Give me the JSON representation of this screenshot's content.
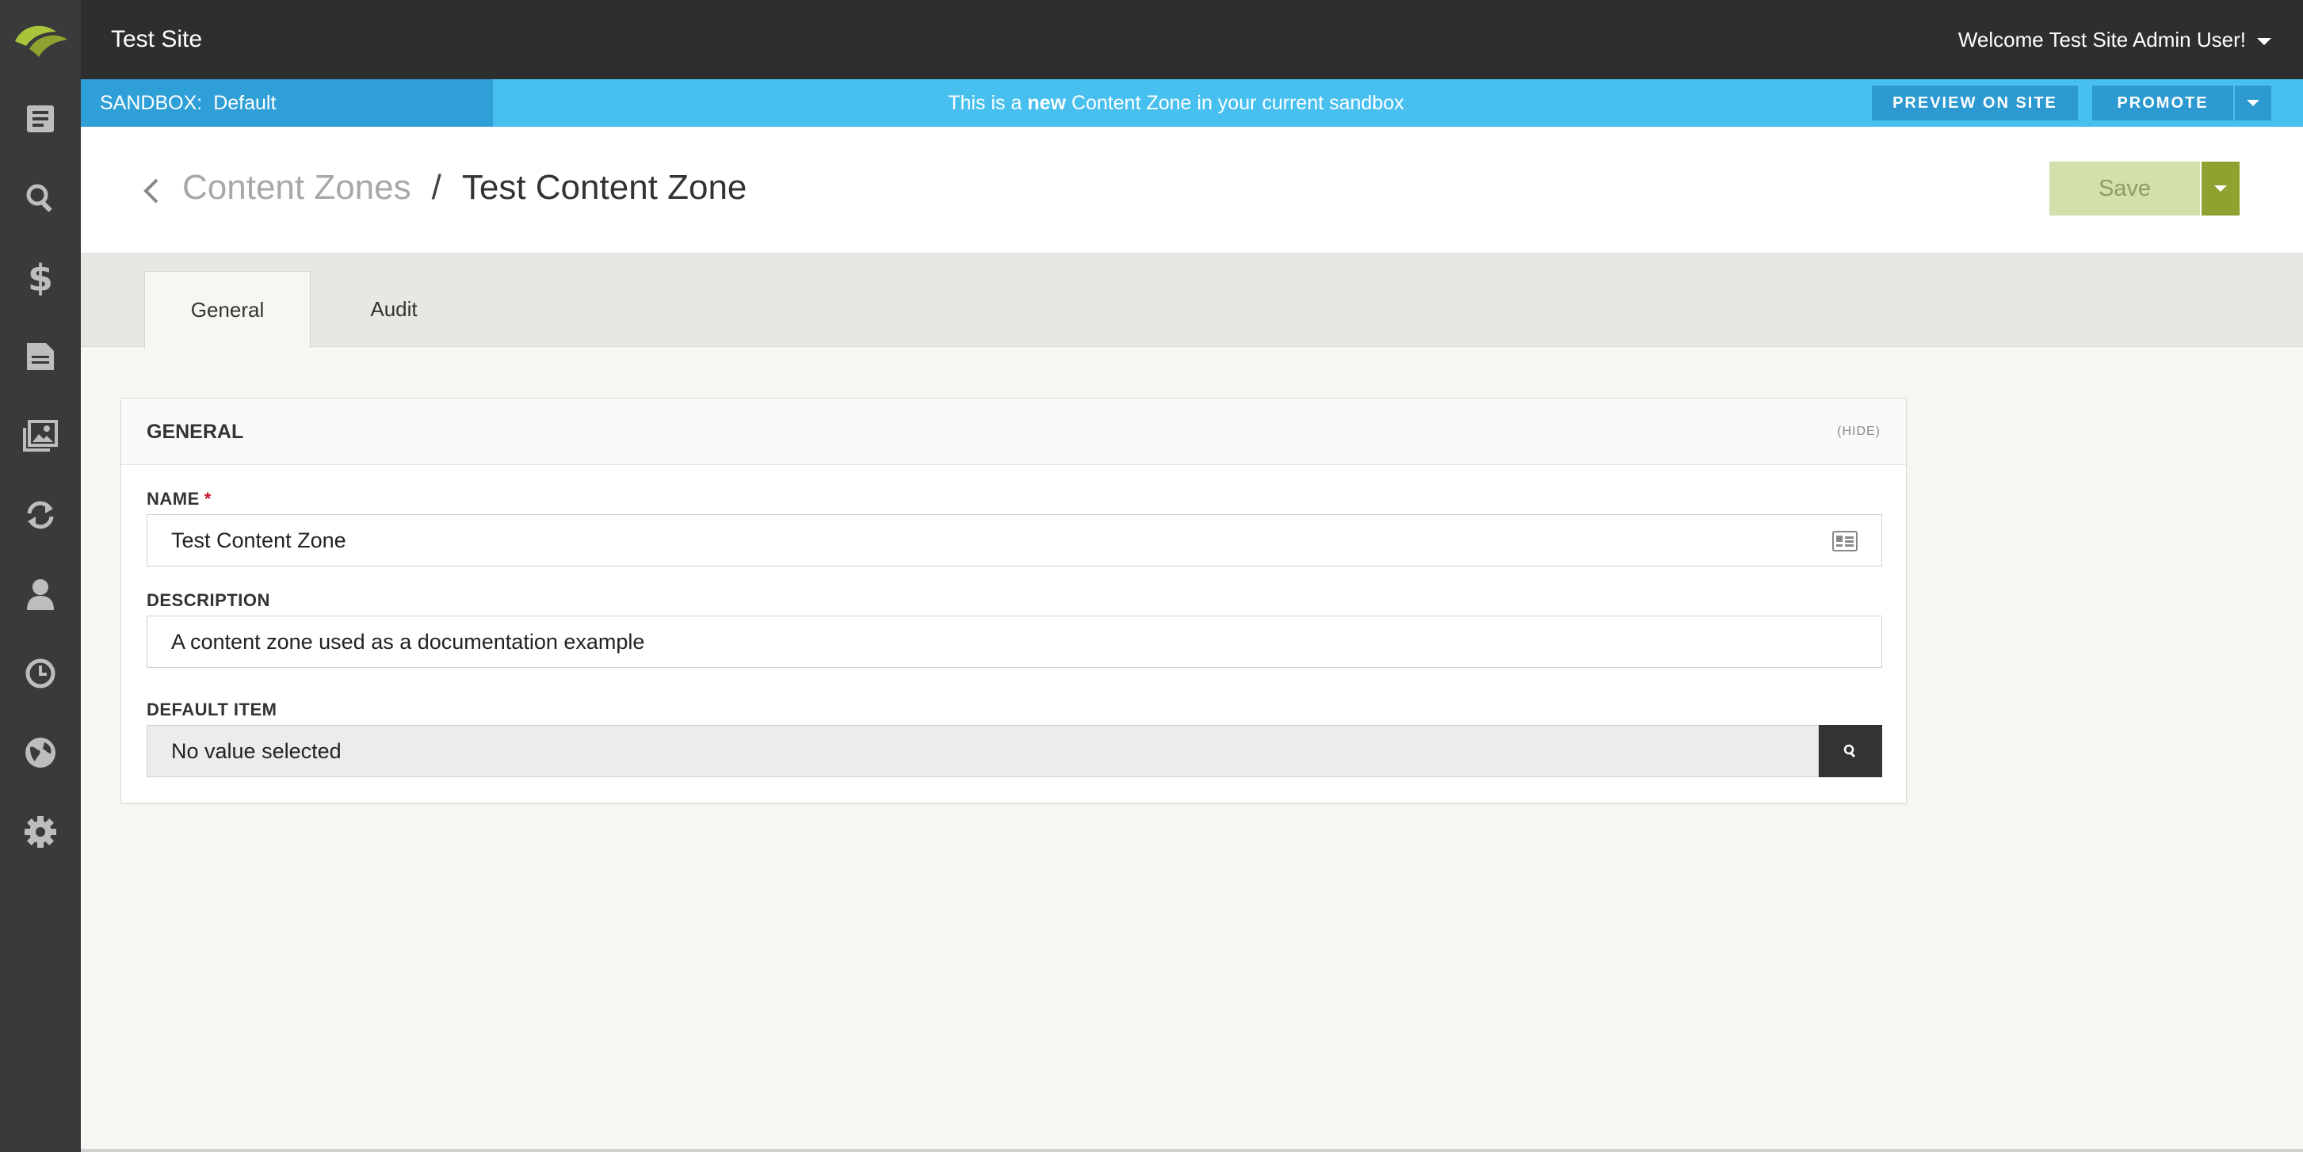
{
  "topbar": {
    "site_title": "Test Site",
    "welcome": "Welcome Test Site Admin User!"
  },
  "nav": {
    "items": [
      "content-icon",
      "search-icon",
      "pricing-icon",
      "catalog-icon",
      "assets-icon",
      "sync-icon",
      "customers-icon",
      "history-icon",
      "sites-icon",
      "settings-icon"
    ]
  },
  "sandbox": {
    "label": "SANDBOX:",
    "value": "Default",
    "message_prefix": "This is a",
    "message_bold": "new",
    "message_suffix": "Content Zone in your current sandbox",
    "preview_label": "PREVIEW ON SITE",
    "promote_label": "PROMOTE"
  },
  "header": {
    "breadcrumb_parent": "Content Zones",
    "separator": "/",
    "breadcrumb_current": "Test Content Zone",
    "save_label": "Save"
  },
  "tabs": [
    {
      "label": "General",
      "active": true
    },
    {
      "label": "Audit",
      "active": false
    }
  ],
  "panel": {
    "title": "GENERAL",
    "hide_label": "(HIDE)",
    "fields": {
      "name": {
        "label": "NAME",
        "required_mark": "*",
        "value": "Test Content Zone"
      },
      "description": {
        "label": "DESCRIPTION",
        "value": "A content zone used as a documentation example"
      },
      "default_item": {
        "label": "DEFAULT ITEM",
        "value": "No value selected"
      }
    }
  },
  "colors": {
    "sandbox_bar": "#47bfef",
    "save_accent": "#8da22f",
    "nav_bg": "#3a3a3a",
    "topbar_bg": "#2e2e2e"
  }
}
